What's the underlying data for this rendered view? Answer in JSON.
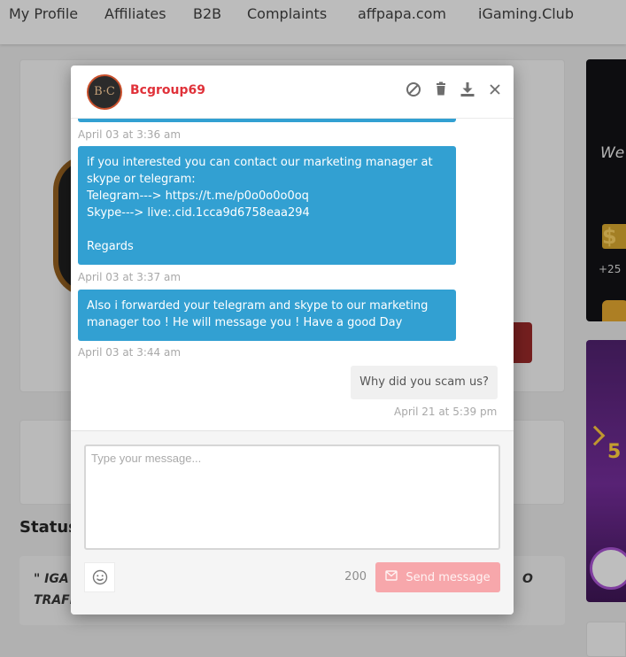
{
  "nav": {
    "items": [
      "My Profile",
      "Affiliates",
      "B2B",
      "Complaints",
      "affpapa.com",
      "iGaming.Club"
    ]
  },
  "background": {
    "status_heading": "Status",
    "quote_line1": "\" IGA",
    "quote_line2": "TRAFI",
    "quote_tail": "O",
    "banner_text": "We",
    "banner_amount": "$",
    "banner_plus": "+25",
    "banner_five": "5"
  },
  "chat": {
    "username": "Bcgroup69",
    "avatar_initials": "B·C",
    "header_icons": [
      "block-icon",
      "trash-icon",
      "download-icon",
      "close-icon"
    ],
    "messages": [
      {
        "direction": "incoming",
        "lines": [
          "if you interested you can contact our marketing manager at",
          "skype or telegram:",
          "Telegram---> https://t.me/p0o0o0o0oq",
          "Skype---> live:.cid.1cca9d6758eaa294",
          "",
          "Regards"
        ]
      },
      {
        "direction": "incoming",
        "lines": [
          "Also i forwarded your telegram and skype to our marketing",
          "manager too ! He will message you ! Have a good Day"
        ]
      },
      {
        "direction": "outgoing",
        "lines": [
          "Why did you scam us?"
        ]
      }
    ],
    "timestamps": [
      "April 03 at 3:36 am",
      "April 03 at 3:37 am",
      "April 03 at 3:44 am",
      "April 21 at 5:39 pm"
    ],
    "composer": {
      "placeholder": "Type your message...",
      "char_count": "200",
      "send_label": "Send message"
    }
  },
  "colors": {
    "incoming_bubble": "#32a0d2",
    "outgoing_bubble": "#f0f0f0",
    "username": "#e0323a",
    "send_button": "#f7a7ab"
  }
}
